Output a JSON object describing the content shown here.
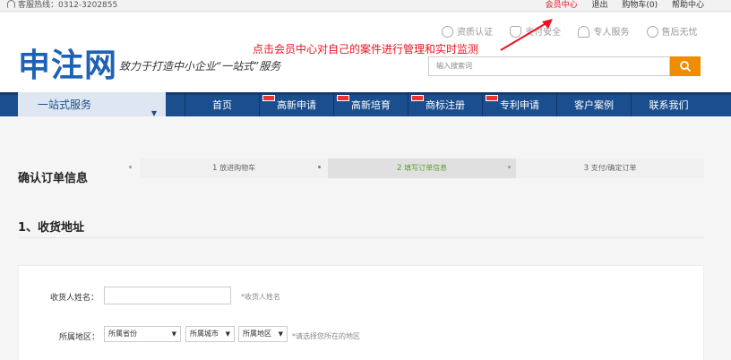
{
  "topbar": {
    "hotline": "客服热线：0312-3202855",
    "links": [
      "会员中心",
      "退出",
      "购物车(0)",
      "帮助中心"
    ]
  },
  "header": {
    "logo": "申注网",
    "slogan": "致力于打造中小企业“一站式”服务",
    "badges": [
      "资质认证",
      "支付安全",
      "专人服务",
      "售后无忧"
    ],
    "annotation": "点击会员中心对自己的案件进行管理和实时监测",
    "search_placeholder": "输入搜索词"
  },
  "nav": {
    "onestop": "一站式服务",
    "items": [
      "首页",
      "高新申请",
      "高新培育",
      "商标注册",
      "专利申请",
      "客户案例",
      "联系我们"
    ]
  },
  "main": {
    "confirm_title": "确认订单信息",
    "steps": [
      {
        "num": "1",
        "label": "放进购物车"
      },
      {
        "num": "2",
        "label": "填写订单信息"
      },
      {
        "num": "3",
        "label": "支付/确定订单"
      }
    ],
    "section_title": "1、收货地址",
    "form": {
      "name_label": "收货人姓名：",
      "name_hint": "*收货人姓名",
      "region_label": "所属地区：",
      "province": "所属省份",
      "city": "所属城市",
      "district": "所属地区",
      "region_hint": "*请选择您所在的地区"
    }
  },
  "colors": {
    "brand_blue": "#1a4e8f",
    "accent_orange": "#f08c00",
    "annotation_red": "#ee1122",
    "step_green": "#5a9e2e"
  }
}
